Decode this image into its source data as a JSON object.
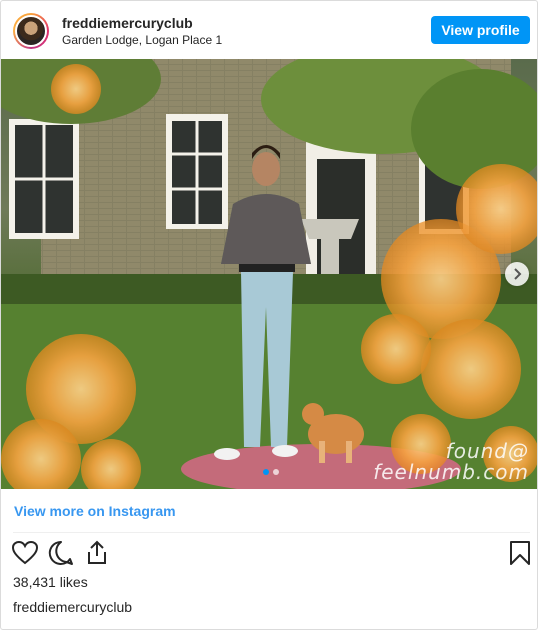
{
  "header": {
    "username": "freddiemercuryclub",
    "location": "Garden Lodge, Logan Place 1",
    "view_profile_label": "View profile"
  },
  "photo": {
    "icon_next": "chevron-right-icon",
    "carousel_position": 1,
    "carousel_total": 2,
    "watermark_line1": "found@",
    "watermark_line2": "feelnumb.com"
  },
  "footer": {
    "view_more_label": "View more on Instagram",
    "likes_text": "38,431 likes",
    "caption_username": "freddiemercuryclub",
    "icons": [
      "heart-icon",
      "comment-icon",
      "share-icon",
      "bookmark-icon"
    ]
  },
  "colors": {
    "accent": "#0095f6",
    "link": "#3897f0",
    "text": "#262626"
  }
}
